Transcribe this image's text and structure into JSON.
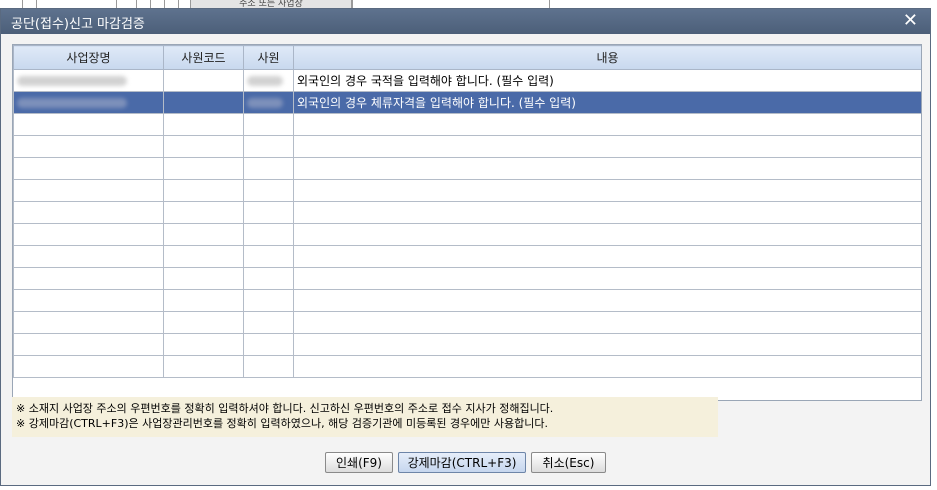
{
  "background": {
    "tab_label": "주소 또는 사업장"
  },
  "dialog": {
    "title": "공단(접수)신고 마감검증",
    "close_glyph": "✕"
  },
  "grid": {
    "columns": [
      "사업장명",
      "사원코드",
      "사원",
      "내용"
    ],
    "rows": [
      {
        "workplace": "",
        "code": "",
        "employee": "",
        "message": "외국인의 경우 국적을 입력해야 합니다. (필수 입력)",
        "selected": false
      },
      {
        "workplace": "",
        "code": "",
        "employee": "",
        "message": "외국인의 경우 체류자격을 입력해야 합니다. (필수 입력)",
        "selected": true
      }
    ]
  },
  "notes": [
    "※ 소재지 사업장 주소의 우편번호를 정확히 입력하셔야 합니다. 신고하신 우편번호의 주소로 접수 지사가 정해집니다.",
    "※ 강제마감(CTRL+F3)은 사업장관리번호를 정확히 입력하였으나, 해당 검증기관에 미등록된 경우에만 사용합니다."
  ],
  "buttons": {
    "print": "인쇄(F9)",
    "force_close": "강제마감(CTRL+F3)",
    "cancel": "취소(Esc)"
  },
  "colors": {
    "titlebar": "#52657f",
    "selected_row": "#4a6aa8",
    "header": "#d3e0f2",
    "notes_bg": "#f5f0dc"
  }
}
